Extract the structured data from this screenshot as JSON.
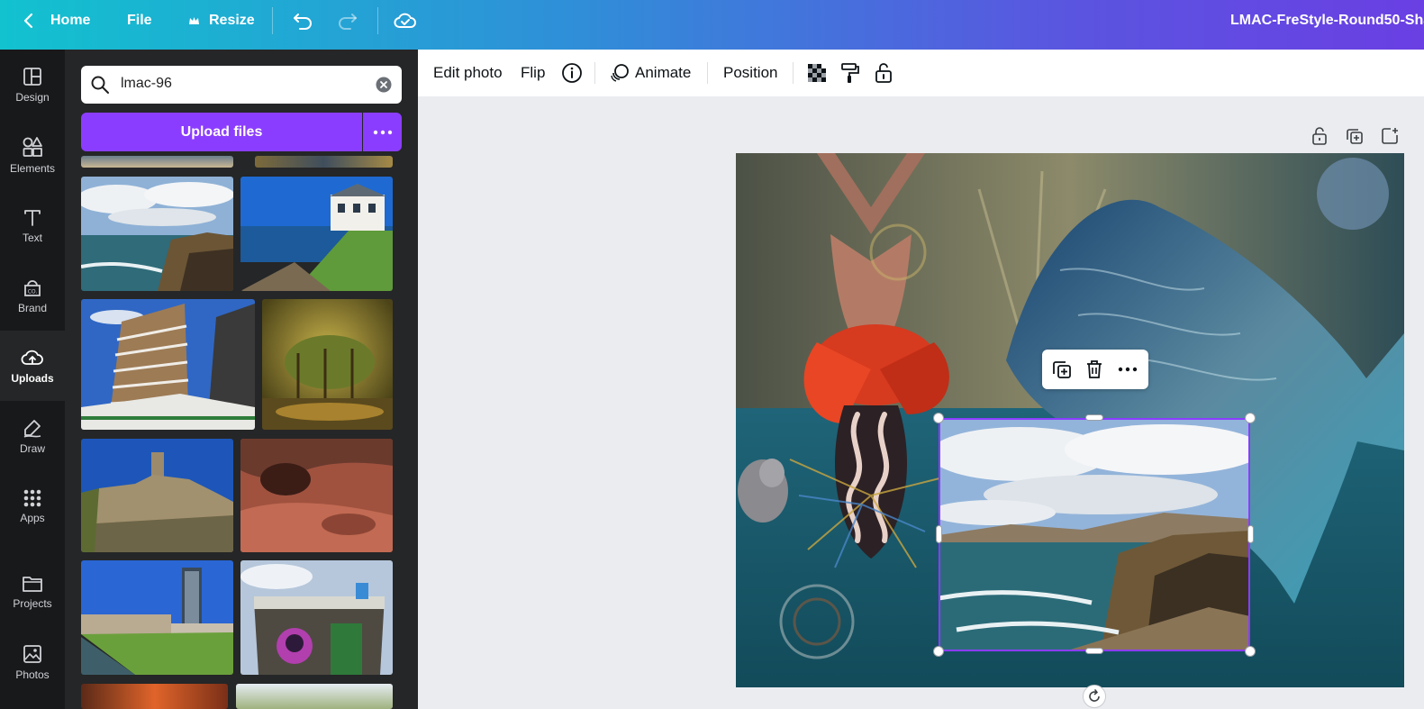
{
  "topbar": {
    "home_label": "Home",
    "file_label": "File",
    "resize_label": "Resize",
    "document_title": "LMAC-FreStyle-Round50-Sha"
  },
  "rail": {
    "items": [
      {
        "label": "Design",
        "icon": "design-layout-icon"
      },
      {
        "label": "Elements",
        "icon": "elements-shapes-icon"
      },
      {
        "label": "Text",
        "icon": "text-t-icon"
      },
      {
        "label": "Brand",
        "icon": "brand-icon"
      },
      {
        "label": "Uploads",
        "icon": "cloud-upload-icon",
        "active": true
      },
      {
        "label": "Draw",
        "icon": "draw-pen-icon"
      },
      {
        "label": "Apps",
        "icon": "apps-grid-icon"
      },
      {
        "label": "Projects",
        "icon": "folder-icon"
      },
      {
        "label": "Photos",
        "icon": "photo-icon"
      }
    ]
  },
  "panel": {
    "search_value": "lmac-96",
    "upload_label": "Upload files"
  },
  "toolbar": {
    "edit_photo": "Edit photo",
    "flip": "Flip",
    "animate": "Animate",
    "position": "Position"
  },
  "colors": {
    "accent": "#8b3dff",
    "panel_bg": "#252627",
    "rail_bg": "#18191b"
  }
}
